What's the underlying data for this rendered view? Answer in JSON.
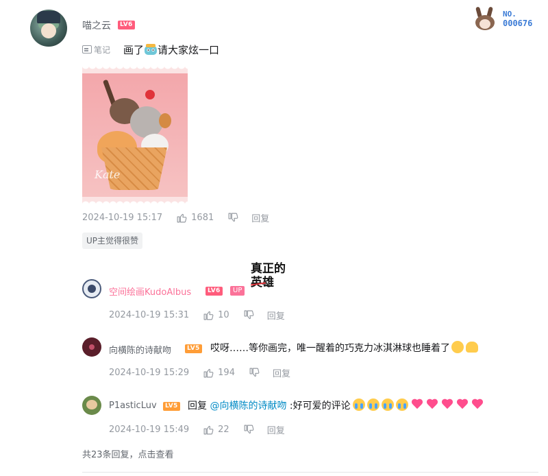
{
  "comment": {
    "username": "喵之云",
    "level": "LV6",
    "note_label": "笔记",
    "text_before": "画了",
    "text_after": "请大家炫一口",
    "art_signature": "Kate",
    "time": "2024-10-19 15:17",
    "likes": "1681",
    "reply_label": "回复",
    "up_liked": "UP主觉得很赞"
  },
  "fan_badge": {
    "label": "NO.",
    "number": "000676"
  },
  "replies": [
    {
      "username": "空间绘画KudoAlbus",
      "level": "LV6",
      "up_badge": "UP",
      "sticker_line1": "真正的",
      "sticker_line2": "英雄",
      "time": "2024-10-19 15:31",
      "likes": "10",
      "reply_label": "回复"
    },
    {
      "username": "向横陈的诗献吻",
      "level": "LV5",
      "text": "哎呀……等你画完，唯一醒着的巧克力冰淇淋球也睡着了",
      "time": "2024-10-19 15:29",
      "likes": "194",
      "reply_label": "回复"
    },
    {
      "username": "P1asticLuv",
      "level": "LV5",
      "reply_prefix": "回复",
      "mention": "@向横陈的诗献吻",
      "text": ":好可爱的评论",
      "time": "2024-10-19 15:49",
      "likes": "22",
      "reply_label": "回复"
    }
  ],
  "total_replies": "共23条回复，点击查看",
  "icons": {
    "like": "thumbs-up-icon",
    "dislike": "thumbs-down-icon",
    "note": "note-icon"
  },
  "colors": {
    "up_name": "#fb7299",
    "mention": "#008ac5",
    "lv6": "#ff5c7c",
    "lv5": "#ff9d37"
  }
}
